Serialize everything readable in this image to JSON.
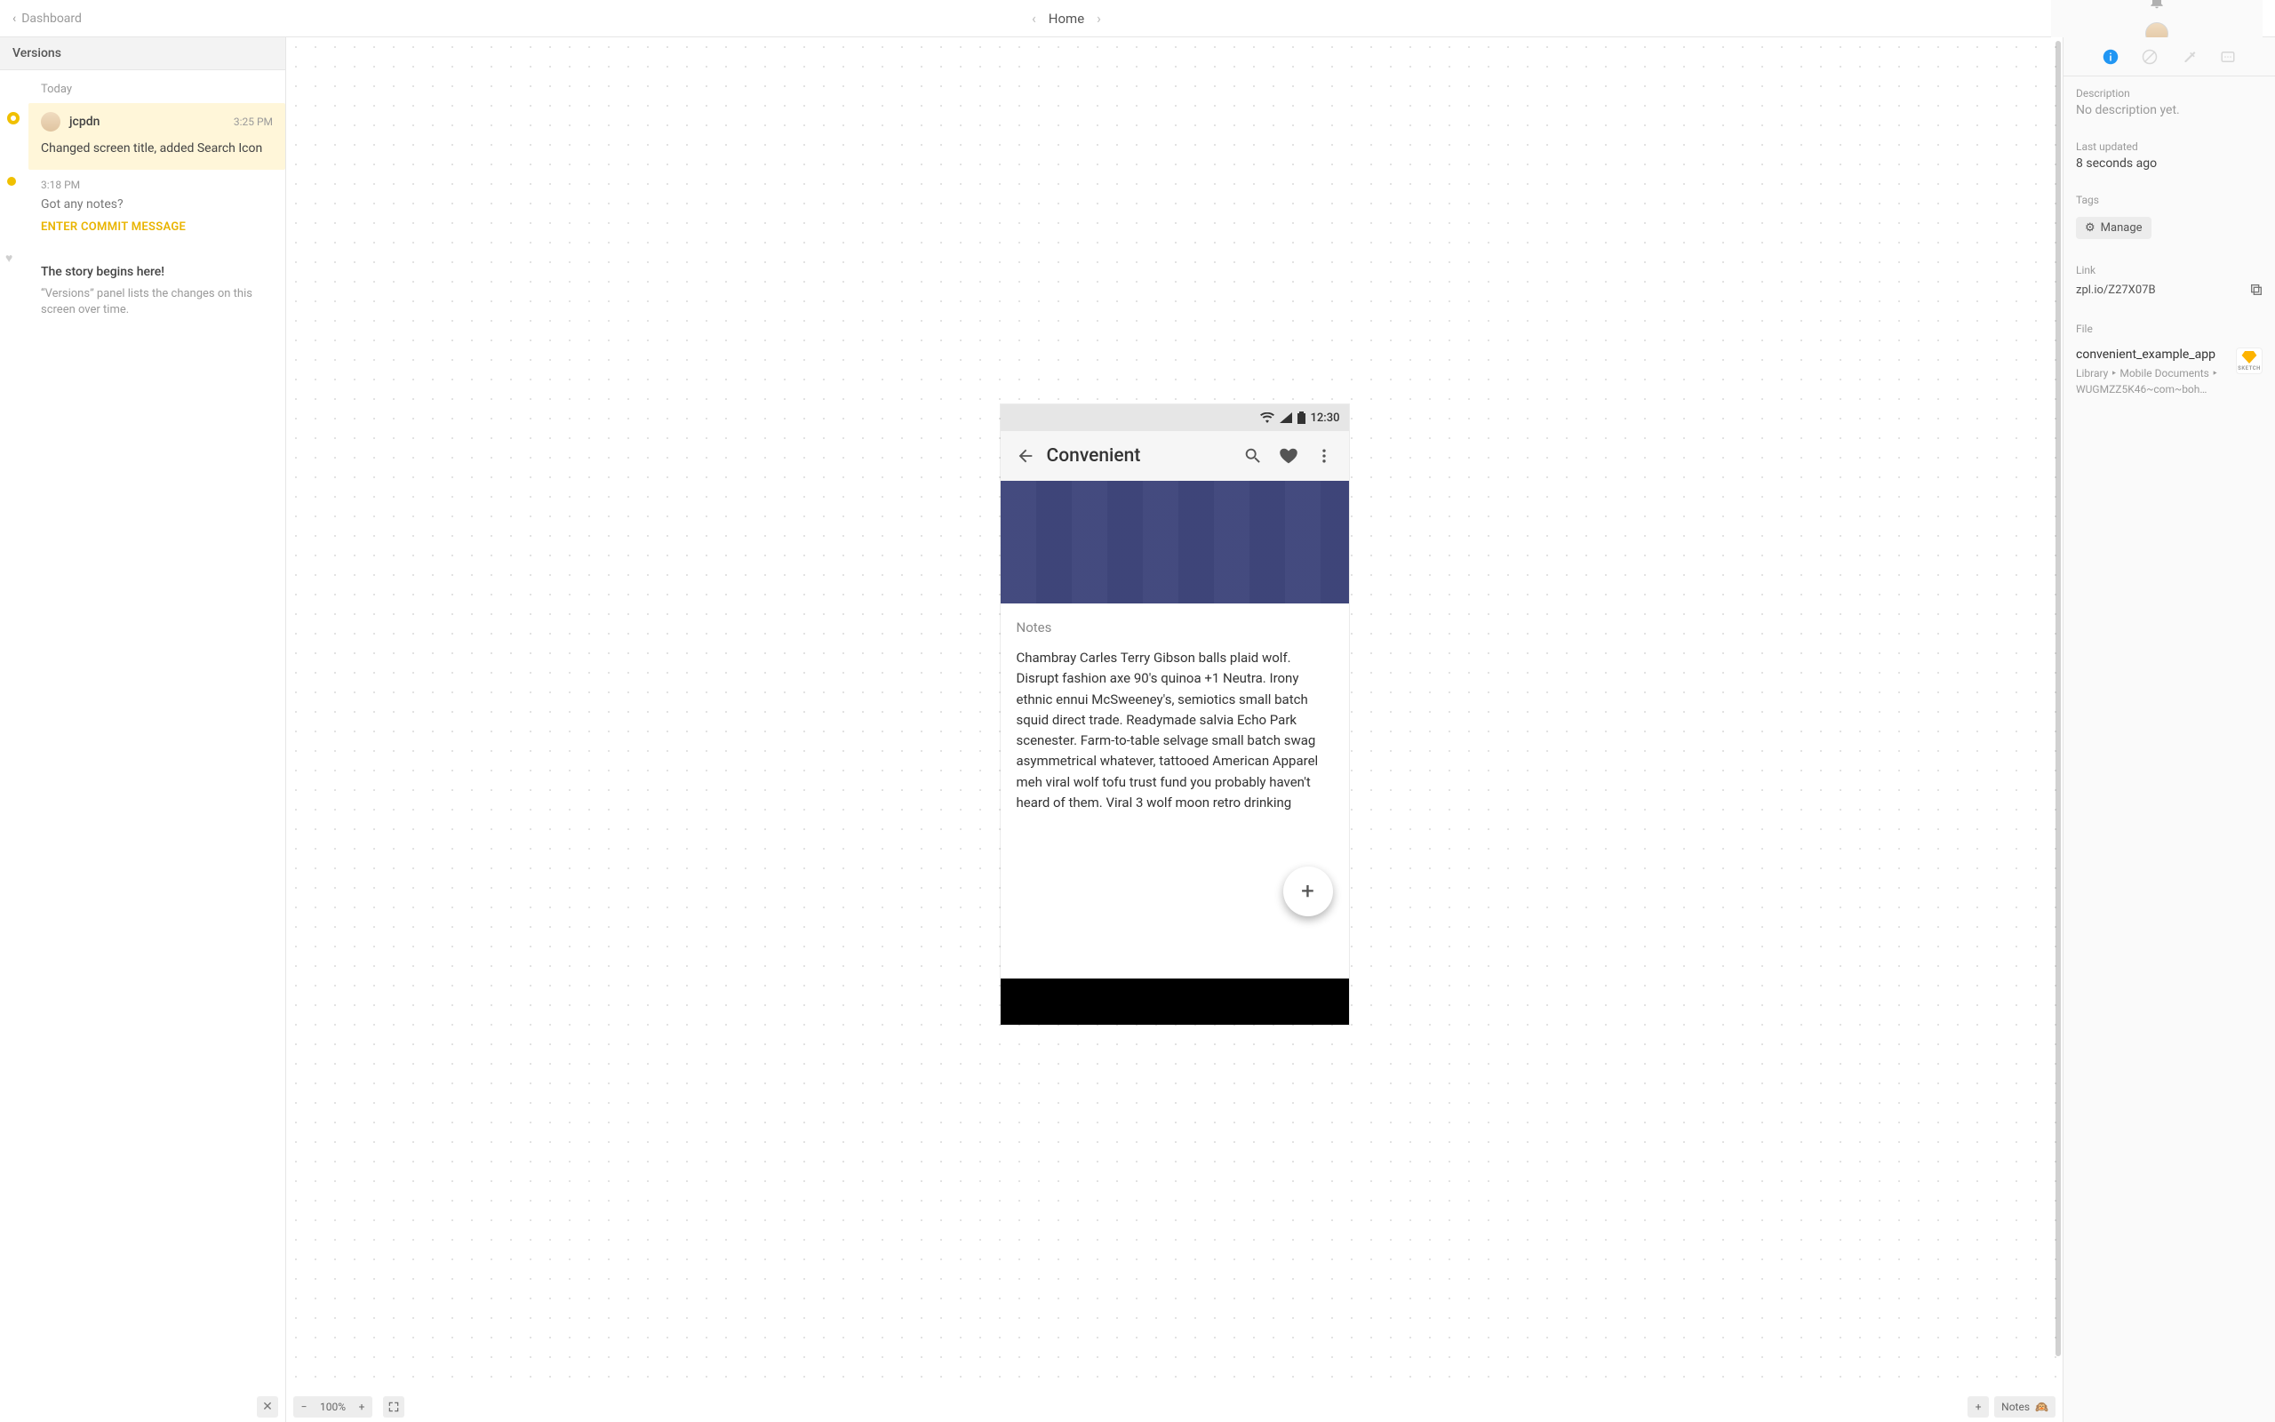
{
  "topbar": {
    "back_label": "Dashboard",
    "title": "Home"
  },
  "sidebar": {
    "header": "Versions",
    "groups": [
      {
        "label": "Today",
        "items": [
          {
            "author": "jcpdn",
            "time": "3:25 PM",
            "message": "Changed screen title, added Search Icon",
            "selected": true
          },
          {
            "time": "3:18 PM",
            "note": "Got any notes?",
            "prompt": "ENTER COMMIT MESSAGE"
          },
          {
            "story_title": "The story begins here!",
            "help": "“Versions” panel lists the changes on this screen over time."
          }
        ]
      }
    ]
  },
  "mockup": {
    "status_time": "12:30",
    "app_title": "Convenient",
    "notes_heading": "Notes",
    "notes_body": "Chambray Carles Terry Gibson balls plaid wolf. Disrupt fashion axe 90's quinoa +1 Neutra. Irony ethnic ennui McSweeney's, semiotics small batch squid direct trade. Readymade salvia Echo Park scenester. Farm-to-table selvage small batch swag asymmetrical whatever, tattooed American Apparel meh viral wolf tofu trust fund you probably haven't heard of them. Viral 3 wolf moon retro drinking"
  },
  "footer": {
    "zoom": "100%",
    "notes_label": "Notes",
    "notes_emoji": "🙉"
  },
  "inspector": {
    "sections": {
      "description_label": "Description",
      "description_value": "No description yet.",
      "last_updated_label": "Last updated",
      "last_updated_value": "8 seconds ago",
      "tags_label": "Tags",
      "manage_label": "Manage",
      "link_label": "Link",
      "link_value": "zpl.io/Z27X07B",
      "file_label": "File",
      "file_name": "convenient_example_app",
      "file_path": "Library ‣ Mobile Documents ‣ WUGMZZ5K46~com~boh…",
      "sketch_label": "SKETCH"
    }
  }
}
